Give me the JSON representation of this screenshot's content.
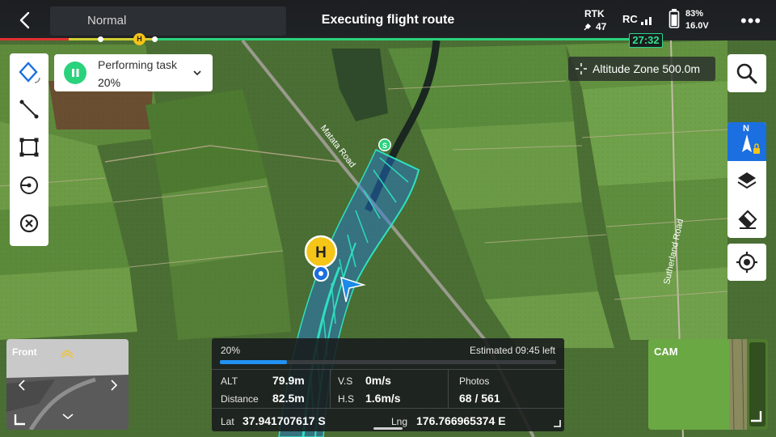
{
  "top_bar": {
    "mode": "Normal",
    "title": "Executing flight route",
    "rtk_label": "RTK",
    "rtk_satellites": "47",
    "rc_label": "RC",
    "battery_percent": "83%",
    "battery_voltage": "16.0V",
    "timer": "27:32",
    "route_progress_marker": "H"
  },
  "task": {
    "status": "Performing task",
    "percent": "20%"
  },
  "altitude_zone": "Altitude Zone 500.0m",
  "map": {
    "road_label_1": "Matata Road",
    "road_label_2": "Sutherland Road",
    "home_marker": "H",
    "start_marker": "S"
  },
  "compass": {
    "north": "N"
  },
  "front_camera": {
    "label": "Front"
  },
  "camera": {
    "label": "CAM"
  },
  "telemetry": {
    "progress_percent": "20%",
    "progress_fraction": 0.2,
    "estimated": "Estimated 09:45 left",
    "alt_label": "ALT",
    "alt_value": "79.9m",
    "distance_label": "Distance",
    "distance_value": "82.5m",
    "vs_label": "V.S",
    "vs_value": "0m/s",
    "hs_label": "H.S",
    "hs_value": "1.6m/s",
    "photos_label": "Photos",
    "photos_value": "68 / 561",
    "lat_label": "Lat",
    "lat_value": "37.941707617 S",
    "lng_label": "Lng",
    "lng_value": "176.766965374 E"
  },
  "colors": {
    "accent_green": "#2ad27c",
    "accent_blue": "#1b6fe0",
    "route_cyan": "#2fe0c8",
    "home_yellow": "#f5c518",
    "progress_red": "#e03030"
  }
}
